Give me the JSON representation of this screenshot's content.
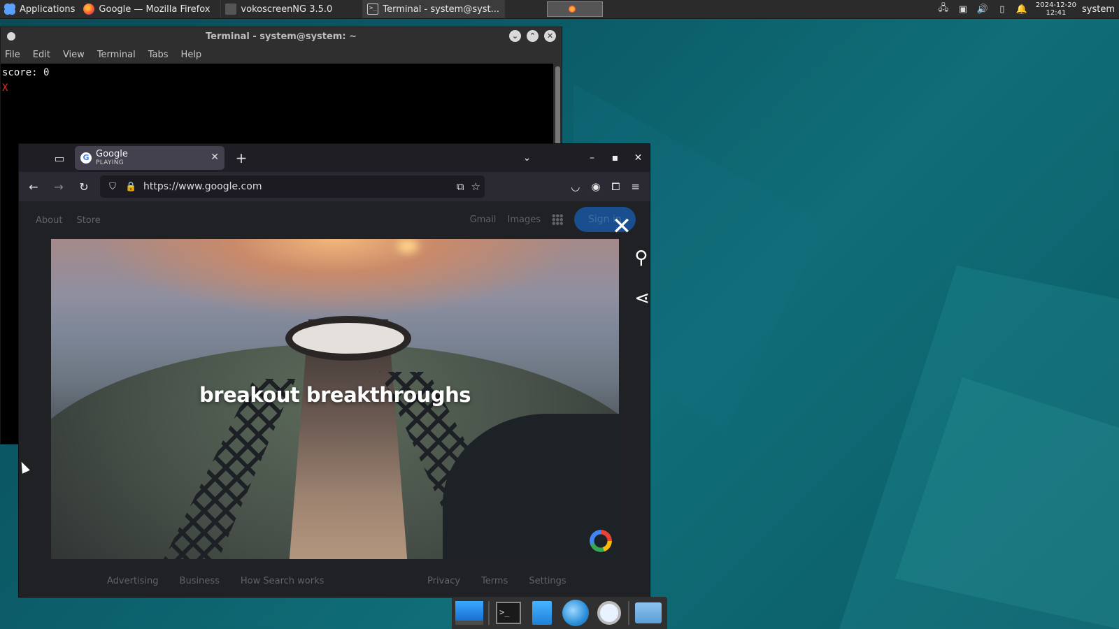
{
  "panel": {
    "applications_label": "Applications",
    "tasks": [
      {
        "label": "Google — Mozilla Firefox"
      },
      {
        "label": "vokoscreenNG 3.5.0"
      },
      {
        "label": "Terminal - system@syst..."
      }
    ],
    "clock_date": "2024-12-20",
    "clock_time": "12:41",
    "user": "system"
  },
  "terminal": {
    "title": "Terminal - system@system: ~",
    "menu": [
      "File",
      "Edit",
      "View",
      "Terminal",
      "Tabs",
      "Help"
    ],
    "lines": [
      "score: 0",
      "X"
    ]
  },
  "firefox": {
    "tab": {
      "title": "Google",
      "subtitle": "PLAYING"
    },
    "url": "https://www.google.com",
    "google": {
      "top_left": [
        "About",
        "Store"
      ],
      "top_right": [
        "Gmail",
        "Images"
      ],
      "sign_in": "Sign in",
      "video_caption": "breakout breakthroughs",
      "footer_left": [
        "Advertising",
        "Business",
        "How Search works"
      ],
      "footer_right": [
        "Privacy",
        "Terms",
        "Settings"
      ]
    }
  },
  "colors": {
    "desktop": "#0b5c68",
    "panel": "#2b2b2b",
    "terminal_bg": "#000000",
    "error_x": "#e0302c",
    "firefox_chrome": "#2b2a33",
    "google_bg": "#202124"
  },
  "icons": {
    "applications": "applications-icon",
    "firefox": "firefox-icon",
    "terminal": "terminal-icon",
    "search_overlay": "magnifier-icon",
    "share": "share-icon"
  }
}
